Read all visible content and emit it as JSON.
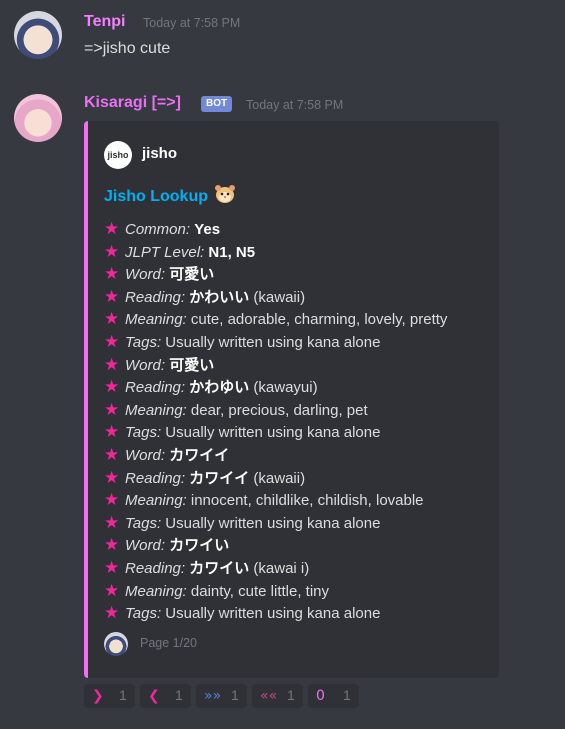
{
  "messages": [
    {
      "username": "Tenpi",
      "timestamp": "Today at 7:58 PM",
      "text": "=>jisho cute"
    },
    {
      "username": "Kisaragi [=>]",
      "bot_tag": "BOT",
      "timestamp": "Today at 7:58 PM",
      "embed": {
        "accent_color": "#f36df3",
        "author_icon_text": "jisho",
        "author_name": "jisho",
        "title": "Jisho Lookup",
        "title_emoji": "hamster-emoji",
        "star_icon": "★",
        "lines": [
          {
            "key": "Common:",
            "value": "Yes",
            "suffix": ""
          },
          {
            "key": "JLPT Level:",
            "value": "N1, N5",
            "suffix": ""
          },
          {
            "key": "Word:",
            "value": "可愛い",
            "suffix": ""
          },
          {
            "key": "Reading:",
            "value": "かわいい",
            "suffix": " (kawaii)"
          },
          {
            "key": "Meaning:",
            "value": "",
            "suffix": " cute, adorable, charming, lovely, pretty"
          },
          {
            "key": "Tags:",
            "value": "",
            "suffix": " Usually written using kana alone"
          },
          {
            "key": "Word:",
            "value": "可愛い",
            "suffix": ""
          },
          {
            "key": "Reading:",
            "value": "かわゆい",
            "suffix": " (kawayui)"
          },
          {
            "key": "Meaning:",
            "value": "",
            "suffix": " dear, precious, darling, pet"
          },
          {
            "key": "Tags:",
            "value": "",
            "suffix": " Usually written using kana alone"
          },
          {
            "key": "Word:",
            "value": "カワイイ",
            "suffix": ""
          },
          {
            "key": "Reading:",
            "value": "カワイイ",
            "suffix": " (kawaii)"
          },
          {
            "key": "Meaning:",
            "value": "",
            "suffix": " innocent, childlike, childish, lovable"
          },
          {
            "key": "Tags:",
            "value": "",
            "suffix": " Usually written using kana alone"
          },
          {
            "key": "Word:",
            "value": "カワイい",
            "suffix": ""
          },
          {
            "key": "Reading:",
            "value": "カワイい",
            "suffix": " (kawai i)"
          },
          {
            "key": "Meaning:",
            "value": "",
            "suffix": " dainty, cute little, tiny"
          },
          {
            "key": "Tags:",
            "value": "",
            "suffix": " Usually written using kana alone"
          }
        ],
        "footer": "Page 1/20"
      },
      "reactions": [
        {
          "icon": "next-arrow-icon",
          "glyph": "❯",
          "color": "#f0269b",
          "count": "1"
        },
        {
          "icon": "prev-arrow-icon",
          "glyph": "❮",
          "color": "#f0269b",
          "count": "1"
        },
        {
          "icon": "fast-forward-icon",
          "glyph": "»»",
          "color": "#5b7fe0",
          "count": "1"
        },
        {
          "icon": "fast-back-icon",
          "glyph": "««",
          "color": "#c04a8a",
          "count": "1"
        },
        {
          "icon": "zero-icon",
          "glyph": "0",
          "color": "#f36df3",
          "count": "1"
        }
      ]
    }
  ]
}
